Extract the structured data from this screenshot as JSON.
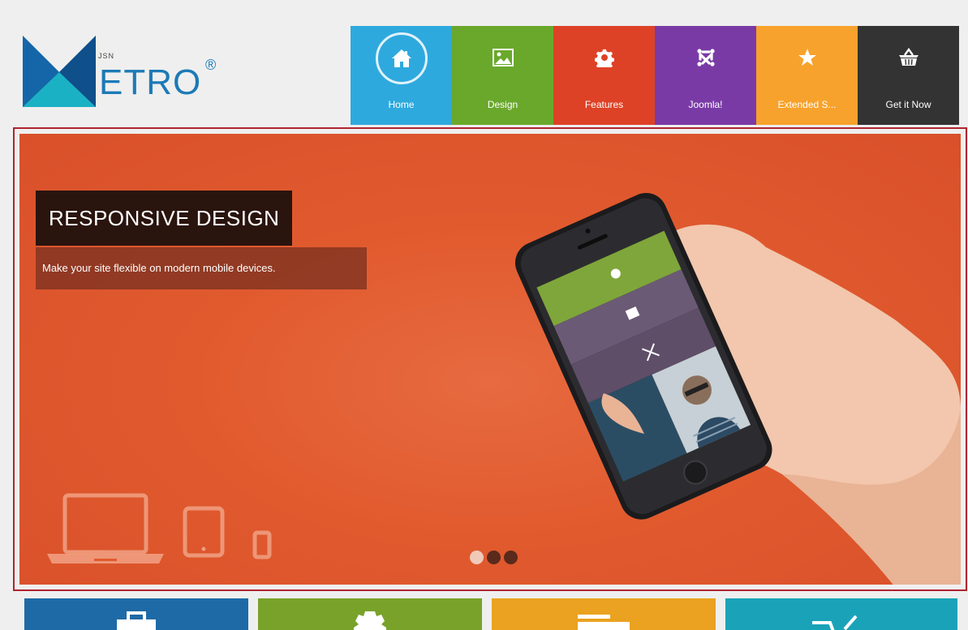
{
  "logo": {
    "word": "ETRO",
    "prefix": "JSN",
    "registered": "®"
  },
  "nav": {
    "items": [
      {
        "label": "Home",
        "color": "#2ea9de",
        "icon": "home-icon"
      },
      {
        "label": "Design",
        "color": "#6aa82c",
        "icon": "image-icon"
      },
      {
        "label": "Features",
        "color": "#de4226",
        "icon": "gear-icon"
      },
      {
        "label": "Joomla!",
        "color": "#7a3aa6",
        "icon": "joomla-icon"
      },
      {
        "label": "Extended S...",
        "color": "#f7a22c",
        "icon": "star-icon"
      },
      {
        "label": "Get it Now",
        "color": "#333333",
        "icon": "basket-icon"
      }
    ]
  },
  "slider": {
    "title": "RESPONSIVE DESIGN",
    "subtitle": "Make your site flexible on modern mobile devices.",
    "active_slide": 1,
    "slide_count": 3,
    "background": "#e25b2e"
  },
  "tiles": [
    {
      "color": "#1e6aa6",
      "icon": "briefcase-icon"
    },
    {
      "color": "#79a22a",
      "icon": "gear-icon"
    },
    {
      "color": "#eaa220",
      "icon": "layout-icon"
    },
    {
      "color": "#1aa3b8",
      "icon": "cart-icon"
    }
  ]
}
